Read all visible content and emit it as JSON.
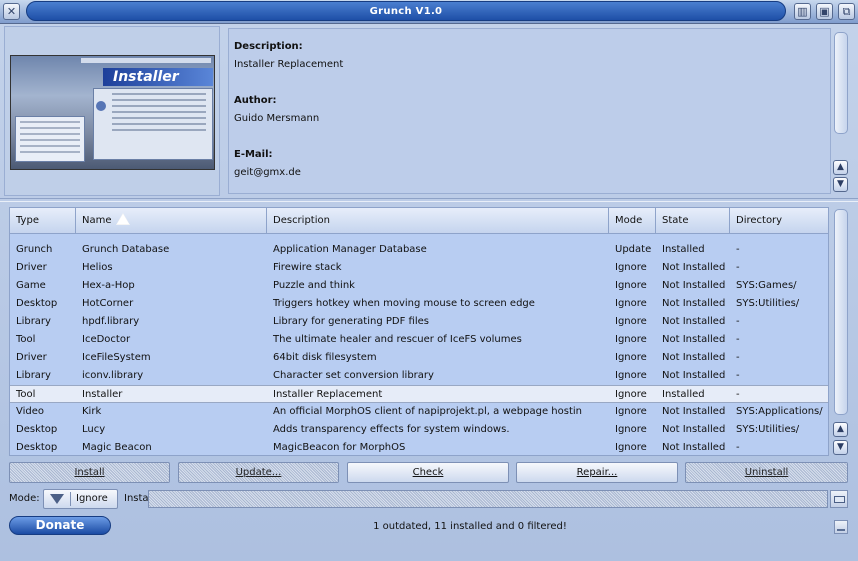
{
  "window": {
    "title": "Grunch V1.0"
  },
  "info": {
    "description_label": "Description:",
    "description": "Installer Replacement",
    "author_label": "Author:",
    "author": "Guido Mersmann",
    "email_label": "E-Mail:",
    "email": "geit@gmx.de"
  },
  "preview": {
    "banner": "Installer"
  },
  "table": {
    "headers": {
      "type": "Type",
      "name": "Name",
      "description": "Description",
      "mode": "Mode",
      "state": "State",
      "directory": "Directory"
    },
    "sort_column": "name",
    "rows": [
      {
        "type": "Grunch",
        "name": "Grunch Database",
        "description": "Application Manager Database",
        "mode": "Update",
        "state": "Installed",
        "directory": "-"
      },
      {
        "type": "Driver",
        "name": "Helios",
        "description": "Firewire stack",
        "mode": "Ignore",
        "state": "Not Installed",
        "directory": "-"
      },
      {
        "type": "Game",
        "name": "Hex-a-Hop",
        "description": "Puzzle and think",
        "mode": "Ignore",
        "state": "Not Installed",
        "directory": "SYS:Games/"
      },
      {
        "type": "Desktop",
        "name": "HotCorner",
        "description": "Triggers hotkey when moving mouse to screen edge",
        "mode": "Ignore",
        "state": "Not Installed",
        "directory": "SYS:Utilities/"
      },
      {
        "type": "Library",
        "name": "hpdf.library",
        "description": "Library for generating PDF files",
        "mode": "Ignore",
        "state": "Not Installed",
        "directory": "-"
      },
      {
        "type": "Tool",
        "name": "IceDoctor",
        "description": "The ultimate healer and rescuer of IceFS volumes",
        "mode": "Ignore",
        "state": "Not Installed",
        "directory": "-"
      },
      {
        "type": "Driver",
        "name": "IceFileSystem",
        "description": "64bit disk filesystem",
        "mode": "Ignore",
        "state": "Not Installed",
        "directory": "-"
      },
      {
        "type": "Library",
        "name": "iconv.library",
        "description": "Character set conversion library",
        "mode": "Ignore",
        "state": "Not Installed",
        "directory": "-"
      },
      {
        "type": "Tool",
        "name": "Installer",
        "description": "Installer Replacement",
        "mode": "Ignore",
        "state": "Installed",
        "directory": "-"
      },
      {
        "type": "Video",
        "name": "Kirk",
        "description": "An official MorphOS client of napiprojekt.pl, a webpage hostin",
        "mode": "Ignore",
        "state": "Not Installed",
        "directory": "SYS:Applications/"
      },
      {
        "type": "Desktop",
        "name": "Lucy",
        "description": "Adds transparency effects for system windows.",
        "mode": "Ignore",
        "state": "Not Installed",
        "directory": "SYS:Utilities/"
      },
      {
        "type": "Desktop",
        "name": "Magic Beacon",
        "description": "MagicBeacon for MorphOS",
        "mode": "Ignore",
        "state": "Not Installed",
        "directory": "-"
      }
    ],
    "selected_index": 8
  },
  "actions": {
    "install": "Install",
    "update": "Update...",
    "check": "Check",
    "repair": "Repair...",
    "uninstall": "Uninstall"
  },
  "mode": {
    "label": "Mode:",
    "value": "Ignore",
    "install_to_label": "Install to"
  },
  "footer": {
    "donate": "Donate",
    "status": "1 outdated, 11 installed and 0 filtered!"
  },
  "colors": {
    "accent": "#1e4fa7",
    "table_bg": "#b8cdf2",
    "selected_row": "#e6ecf8"
  }
}
